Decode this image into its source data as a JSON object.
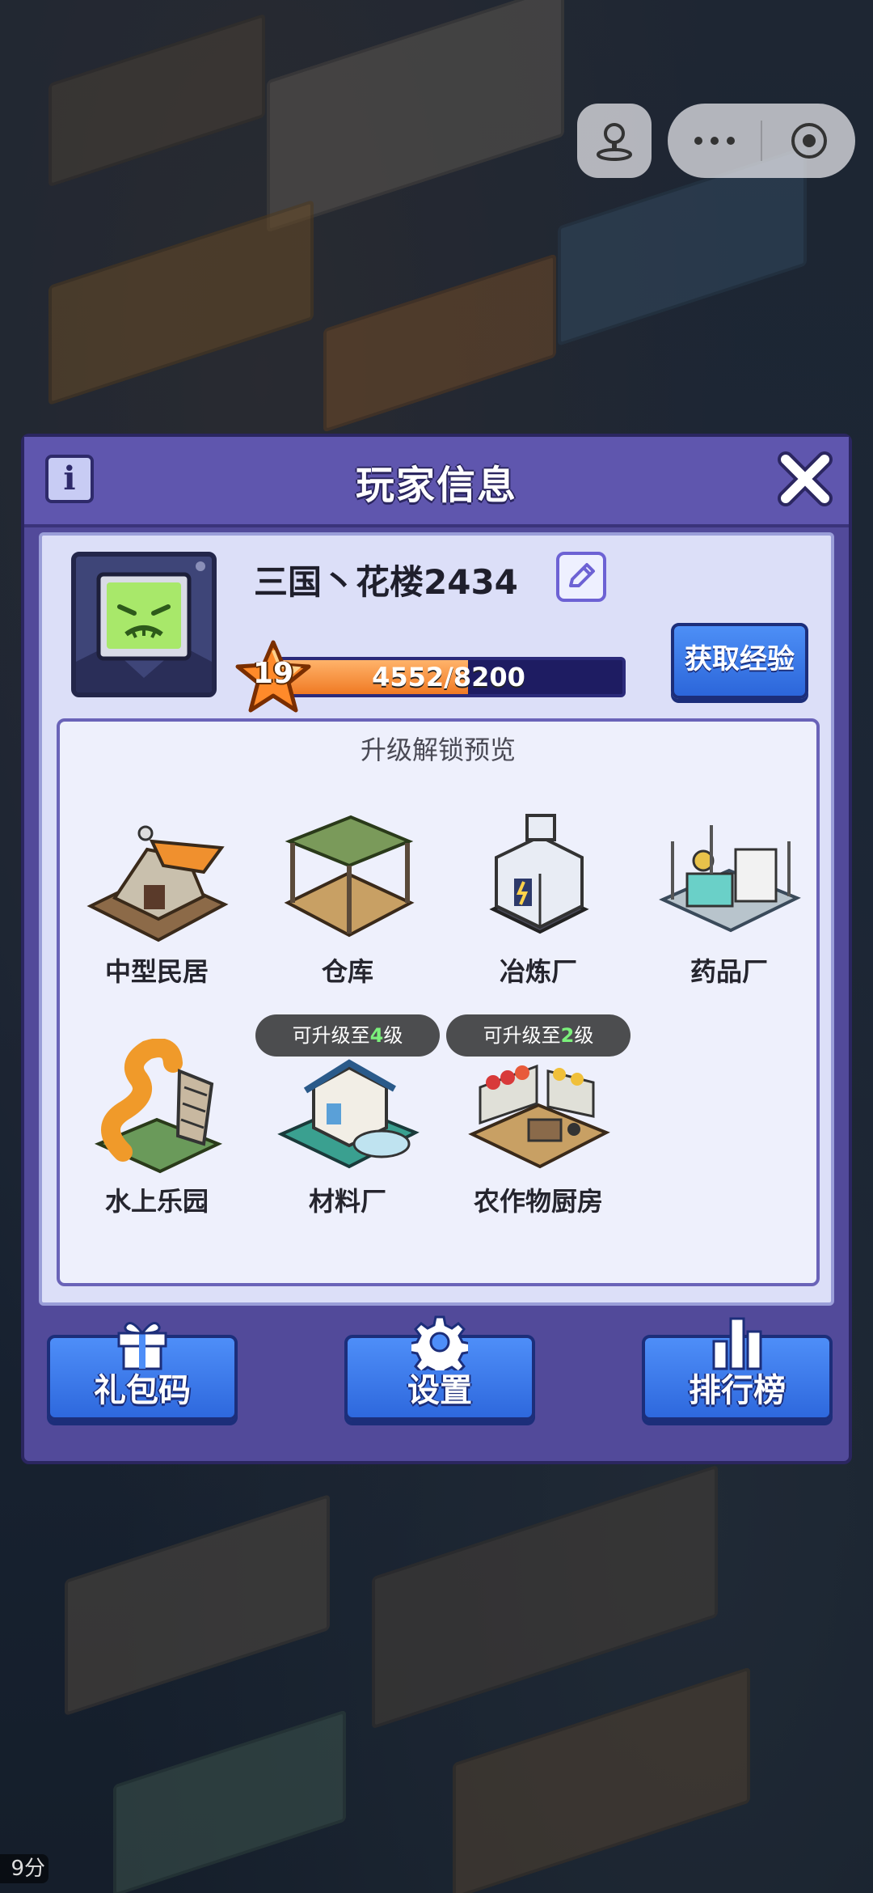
{
  "panel": {
    "title": "玩家信息",
    "info_glyph": "i"
  },
  "player": {
    "name": "三国丶花楼2434",
    "level": "19",
    "exp_text": "4552/8200",
    "exp_progress": 0.555
  },
  "actions": {
    "get_exp_label": "获取经验"
  },
  "preview": {
    "title": "升级解锁预览",
    "buildings": [
      {
        "name": "中型民居",
        "badge": null
      },
      {
        "name": "仓库",
        "badge": null
      },
      {
        "name": "冶炼厂",
        "badge": null
      },
      {
        "name": "药品厂",
        "badge": null
      },
      {
        "name": "水上乐园",
        "badge": null
      },
      {
        "name": "材料厂",
        "badge": {
          "prefix": "可升级至",
          "level": "4",
          "suffix": "级"
        }
      },
      {
        "name": "农作物厨房",
        "badge": {
          "prefix": "可升级至",
          "level": "2",
          "suffix": "级"
        }
      }
    ]
  },
  "bottom": {
    "gift_label": "礼包码",
    "settings_label": "设置",
    "rank_label": "排行榜"
  },
  "corner_timer": "9分",
  "icons": [
    "info-icon",
    "close-icon",
    "edit-icon",
    "star-icon",
    "gift-icon",
    "gear-icon",
    "bar-chart-icon",
    "joystick-icon",
    "more-icon",
    "record-icon"
  ],
  "colors": {
    "accent": "#2e68dd",
    "panel": "#524a9a",
    "xp_fill": "#f07a24",
    "badge_highlight": "#7bf07b"
  }
}
